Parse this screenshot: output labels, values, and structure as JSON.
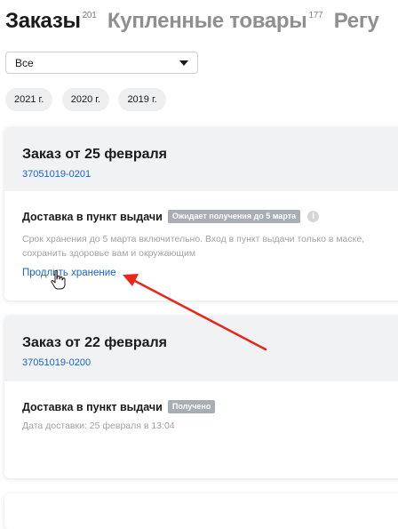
{
  "tabs": [
    {
      "label": "Заказы",
      "count": "201",
      "active": true
    },
    {
      "label": "Купленные товары",
      "count": "177",
      "active": false
    },
    {
      "label": "Регу",
      "count": "",
      "active": false
    }
  ],
  "filter": {
    "selected": "Все"
  },
  "years": [
    "2021 г.",
    "2020 г.",
    "2019 г."
  ],
  "orders": [
    {
      "title": "Заказ от 25 февраля",
      "number": "37051019-0201",
      "delivery_label": "Доставка в пункт выдачи",
      "status": "Ожидает получения до 5 марта",
      "note_line1": "Срок хранения до 5 марта включительно. Вход в пункт выдачи только в маске,",
      "note_line2": "сохранить здоровье вам и окружающим",
      "action": "Продлить хранение"
    },
    {
      "title": "Заказ от 22 февраля",
      "number": "37051019-0200",
      "delivery_label": "Доставка в пункт выдачи",
      "status": "Получено",
      "date_text": "Дата доставки: 25 февраля в 13:04"
    }
  ],
  "colors": {
    "link": "#1e62c6",
    "badge": "#a9aeb5",
    "arrow": "#e8261c",
    "header_bg": "#f1f2f4"
  }
}
